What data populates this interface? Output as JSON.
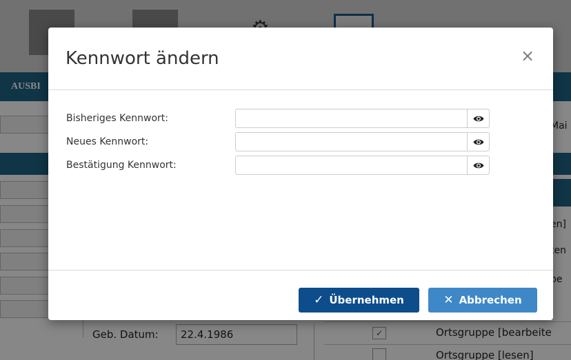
{
  "background": {
    "nav_label": "AUSBI",
    "right_texts": [
      "Mai",
      "en]",
      "ten",
      "be"
    ],
    "ortsgruppe_rows": [
      "Ortsgruppe [bearbeite",
      "Ortsgruppe [lesen]"
    ],
    "geb_label": "Geb. Datum:",
    "geb_value": "22.4.1986"
  },
  "dialog": {
    "title": "Kennwort ändern",
    "close_symbol": "×",
    "fields": [
      {
        "label": "Bisheriges Kennwort:",
        "value": ""
      },
      {
        "label": "Neues Kennwort:",
        "value": ""
      },
      {
        "label": "Bestätigung Kennwort:",
        "value": ""
      }
    ],
    "apply_icon": "✓",
    "apply_label": "Übernehmen",
    "cancel_icon": "✕",
    "cancel_label": "Abbrechen"
  },
  "colors": {
    "primary": "#0d4d8c",
    "secondary": "#3f88c7",
    "navbar": "#1f6485"
  }
}
